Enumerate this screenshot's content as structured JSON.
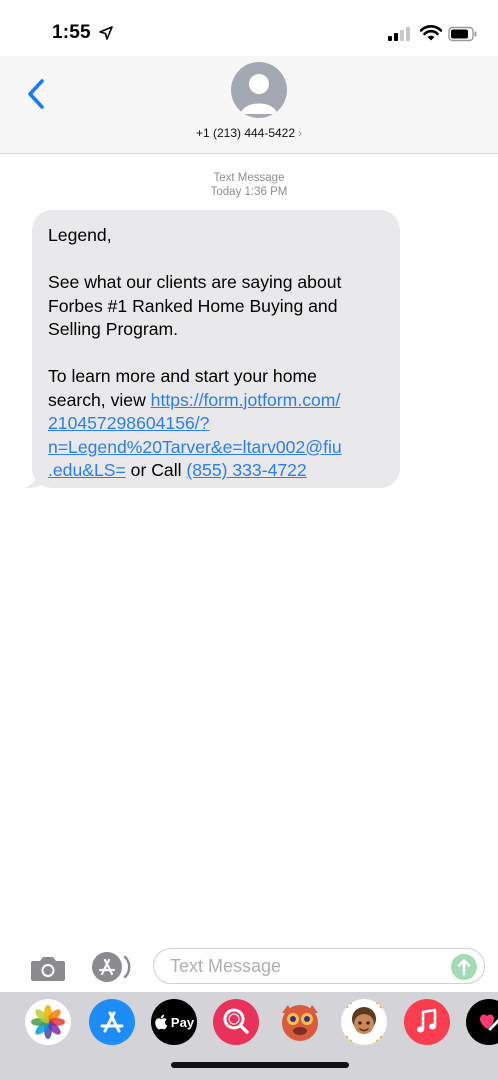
{
  "status_bar": {
    "time": "1:55",
    "icons": [
      "location-arrow-icon",
      "cellular-signal-icon",
      "wifi-icon",
      "battery-icon"
    ]
  },
  "header": {
    "back_icon": "chevron-left-icon",
    "avatar_icon": "person-silhouette-icon",
    "contact_number": "+1 (213) 444-5422",
    "contact_chevron": "›"
  },
  "conversation": {
    "meta_type": "Text Message",
    "meta_time": "Today 1:36 PM",
    "message": {
      "greeting": "Legend,",
      "line1": "See what our clients are saying about",
      "line2": "Forbes #1 Ranked Home Buying and",
      "line3": "Selling Program.",
      "line4": "To learn more and start your home",
      "line5_prefix": "search, view ",
      "link_part1": "https://form.jotform.com/",
      "link_part2": "210457298604156/?",
      "link_part3": "n=Legend%20Tarver&e=ltarv002@fiu",
      "link_part4": ".edu&LS=",
      "or_call": " or Call ",
      "phone_link": "(855) 333-4722"
    }
  },
  "compose": {
    "placeholder": "Text Message",
    "camera_icon": "camera-icon",
    "appstore_icon": "app-store-icon",
    "send_icon": "send-arrow-up-icon"
  },
  "app_drawer": {
    "apps": [
      {
        "name": "photos-app-icon"
      },
      {
        "name": "app-store-app-icon"
      },
      {
        "name": "apple-pay-app-icon",
        "label": "Pay"
      },
      {
        "name": "images-search-app-icon"
      },
      {
        "name": "animoji-app-icon"
      },
      {
        "name": "memoji-app-icon"
      },
      {
        "name": "music-app-icon"
      },
      {
        "name": "digital-touch-app-icon"
      }
    ]
  },
  "colors": {
    "link": "#2a7ef0",
    "bubble_received": "#e9e9eb",
    "ios_blue": "#1a7cf5",
    "send_button": "#a3dbb5"
  }
}
